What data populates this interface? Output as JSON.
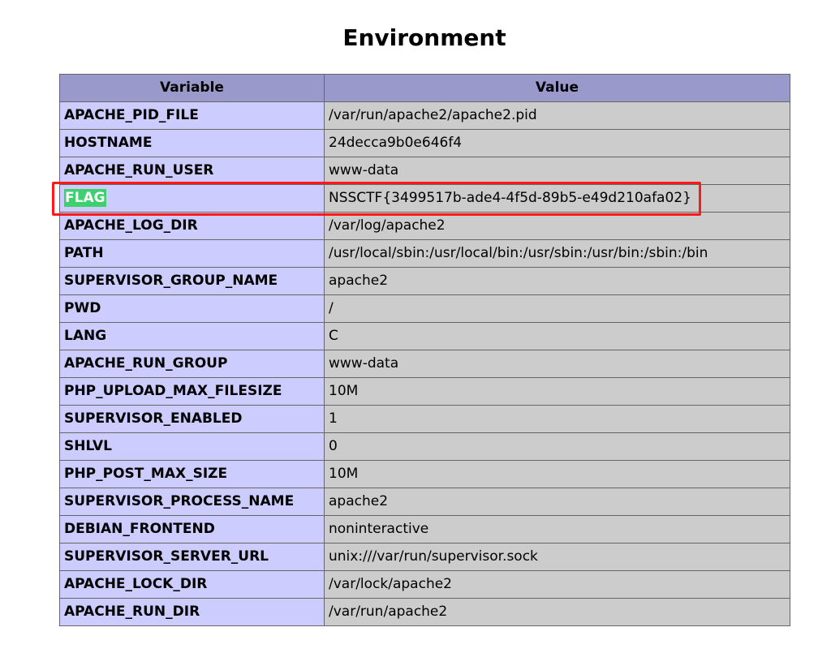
{
  "page": {
    "title": "Environment"
  },
  "table": {
    "headers": {
      "variable": "Variable",
      "value": "Value"
    },
    "rows": [
      {
        "variable": "APACHE_PID_FILE",
        "value": "/var/run/apache2/apache2.pid"
      },
      {
        "variable": "HOSTNAME",
        "value": "24decca9b0e646f4"
      },
      {
        "variable": "APACHE_RUN_USER",
        "value": "www-data"
      },
      {
        "variable": "FLAG",
        "value": "NSSCTF{3499517b-ade4-4f5d-89b5-e49d210afa02}"
      },
      {
        "variable": "APACHE_LOG_DIR",
        "value": "/var/log/apache2"
      },
      {
        "variable": "PATH",
        "value": "/usr/local/sbin:/usr/local/bin:/usr/sbin:/usr/bin:/sbin:/bin"
      },
      {
        "variable": "SUPERVISOR_GROUP_NAME",
        "value": "apache2"
      },
      {
        "variable": "PWD",
        "value": "/"
      },
      {
        "variable": "LANG",
        "value": "C"
      },
      {
        "variable": "APACHE_RUN_GROUP",
        "value": "www-data"
      },
      {
        "variable": "PHP_UPLOAD_MAX_FILESIZE",
        "value": "10M"
      },
      {
        "variable": "SUPERVISOR_ENABLED",
        "value": "1"
      },
      {
        "variable": "SHLVL",
        "value": "0"
      },
      {
        "variable": "PHP_POST_MAX_SIZE",
        "value": "10M"
      },
      {
        "variable": "SUPERVISOR_PROCESS_NAME",
        "value": "apache2"
      },
      {
        "variable": "DEBIAN_FRONTEND",
        "value": "noninteractive"
      },
      {
        "variable": "SUPERVISOR_SERVER_URL",
        "value": "unix:///var/run/supervisor.sock"
      },
      {
        "variable": "APACHE_LOCK_DIR",
        "value": "/var/lock/apache2"
      },
      {
        "variable": "APACHE_RUN_DIR",
        "value": "/var/run/apache2"
      }
    ]
  },
  "colors": {
    "header_bg": "#9999cc",
    "variable_bg": "#ccccff",
    "value_bg": "#cccccc",
    "highlight_bg": "#3ecf6e",
    "annotation_border": "#ff1a1a"
  }
}
